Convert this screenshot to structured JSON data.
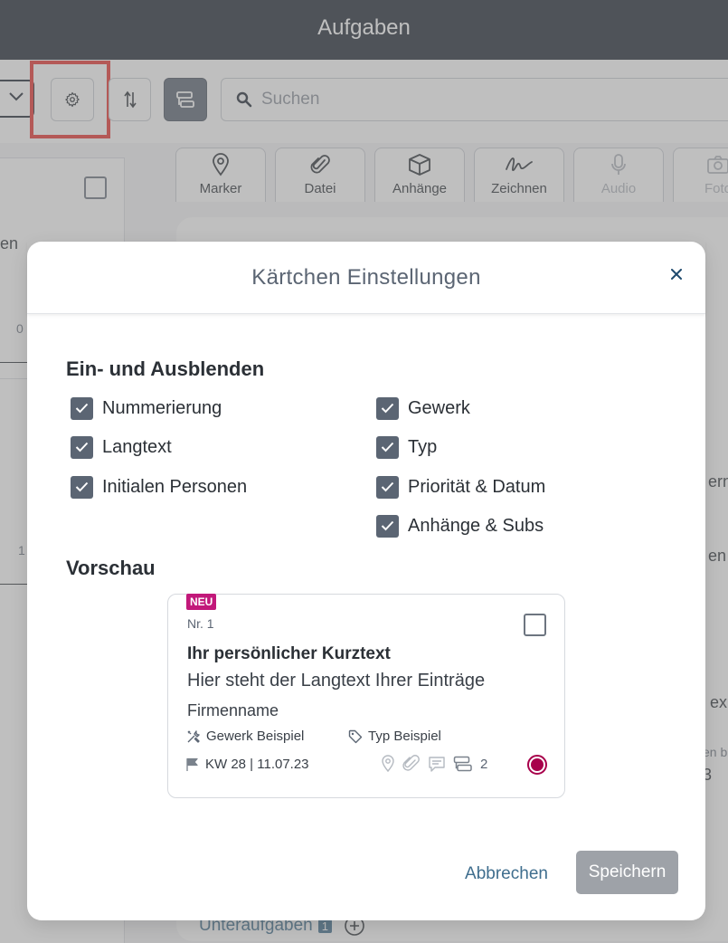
{
  "app": {
    "title": "Aufgaben"
  },
  "toolbar": {
    "search_placeholder": "Suchen",
    "attachments": [
      {
        "label": "Marker",
        "icon": "map-pin-icon",
        "enabled": true
      },
      {
        "label": "Datei",
        "icon": "paperclip-icon",
        "enabled": true
      },
      {
        "label": "Anhänge",
        "icon": "box-icon",
        "enabled": true
      },
      {
        "label": "Zeichnen",
        "icon": "signature-icon",
        "enabled": true
      },
      {
        "label": "Audio",
        "icon": "microphone-icon",
        "enabled": false
      },
      {
        "label": "Foto",
        "icon": "camera-icon",
        "enabled": false
      }
    ]
  },
  "background": {
    "left_fragments": [
      "en",
      "0",
      "1"
    ],
    "right_fragments": [
      "ern",
      "en",
      "ex",
      "en b",
      "3"
    ],
    "subtasks_label": "Unteraufgaben",
    "subtasks_count": "1"
  },
  "modal": {
    "title": "Kärtchen Einstellungen",
    "section_visibility": "Ein- und Ausblenden",
    "options_left": [
      {
        "label": "Nummerierung",
        "checked": true
      },
      {
        "label": "Langtext",
        "checked": true
      },
      {
        "label": "Initialen Personen",
        "checked": true
      }
    ],
    "options_right": [
      {
        "label": "Gewerk",
        "checked": true
      },
      {
        "label": "Typ",
        "checked": true
      },
      {
        "label": "Priorität & Datum",
        "checked": true
      },
      {
        "label": "Anhänge & Subs",
        "checked": true
      }
    ],
    "section_preview": "Vorschau",
    "preview": {
      "badge": "NEU",
      "number": "Nr. 1",
      "short_text": "Ihr persönlicher Kurztext",
      "long_text": "Hier steht der Langtext Ihrer Einträge",
      "company": "Firmenname",
      "trade": "Gewerk Beispiel",
      "type": "Typ Beispiel",
      "date": "KW 28 | 11.07.23",
      "subtask_count": "2",
      "priority_color": "#a8004b"
    },
    "cancel_label": "Abbrechen",
    "save_label": "Speichern"
  },
  "colors": {
    "topbar": "#1e2633",
    "checkbox": "#5b6573",
    "link": "#3f6e8e",
    "badge": "#c2187a",
    "highlight": "#e8322e"
  }
}
